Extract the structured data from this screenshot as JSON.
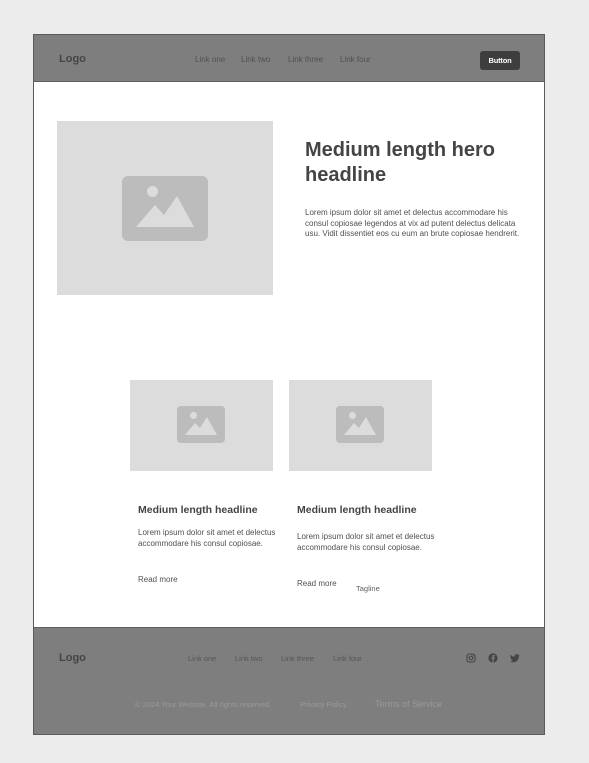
{
  "header": {
    "logo": "Logo",
    "nav": [
      "Link one",
      "Link two",
      "Link three",
      "Link four"
    ],
    "button_label": "Button"
  },
  "hero": {
    "image_icon": "image-placeholder-icon",
    "headline": "Medium length hero headline",
    "body": "Lorem ipsum dolor sit amet et delectus accommodare his consul copiosae legendos at vix ad putent delectus delicata usu. Vidit dissentiet eos cu eum an brute copiosae hendrerit."
  },
  "cards": [
    {
      "image_icon": "image-placeholder-icon",
      "headline": "Medium length headline",
      "body": "Lorem ipsum dolor sit amet et delectus accommodare his consul copiosae.",
      "link": "Read more"
    },
    {
      "image_icon": "image-placeholder-icon",
      "headline": "Medium length headline",
      "body": "Lorem ipsum dolor sit amet et delectus accommodare his consul copiosae.",
      "link": "Read more",
      "tagline": "Tagline"
    }
  ],
  "footer": {
    "logo": "Logo",
    "nav": [
      "Link one",
      "Link two",
      "Link three",
      "Link four"
    ],
    "social_icons": [
      "instagram-icon",
      "facebook-icon",
      "twitter-icon"
    ],
    "copyright": "© 2024 Your Website. All rights reserved.",
    "privacy": "Privacy Policy",
    "terms": "Terms of Service"
  },
  "colors": {
    "background": "#ececec",
    "bar": "#7e7e7e",
    "placeholder": "#dcdcdc",
    "placeholder_icon": "#bcbcbc",
    "button": "#3e3e3e"
  }
}
